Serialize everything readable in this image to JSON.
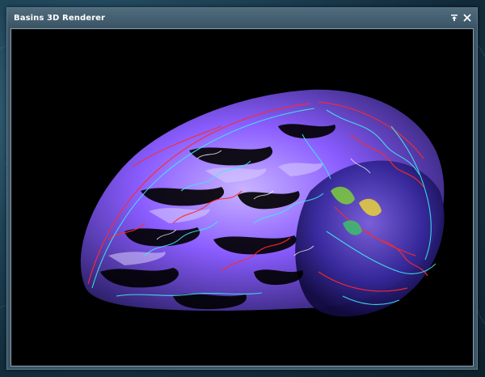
{
  "window": {
    "title": "Basins 3D Renderer",
    "controls": {
      "pin_icon": "pin-icon",
      "close_icon": "close-icon"
    }
  },
  "viewport": {
    "background": "#000000",
    "scene_colors": {
      "primary_surface": "#8a5cff",
      "light_surface": "#b9a2ff",
      "dark_surface": "#2a1f66",
      "edge_red": "#ff2a2a",
      "edge_cyan": "#3fe8f0",
      "highlight_white": "#ffffff"
    }
  },
  "desktop": {
    "background_color": "#1f4458"
  }
}
